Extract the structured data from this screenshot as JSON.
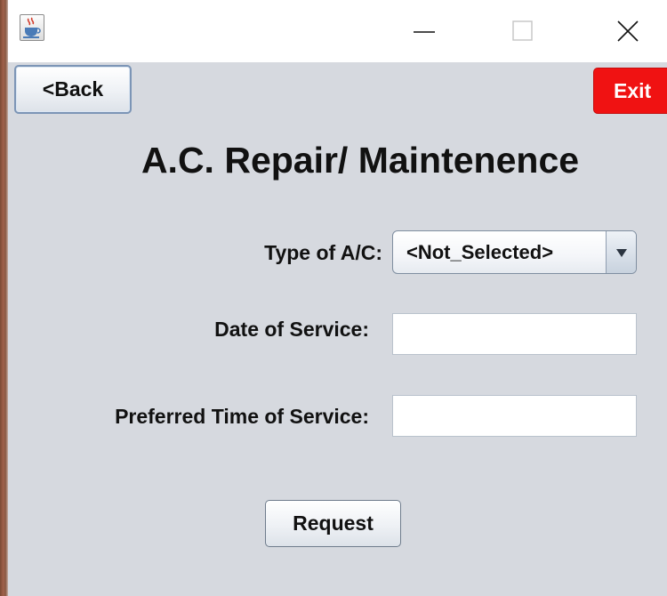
{
  "window": {
    "controls": [
      "minimize-icon",
      "maximize-icon",
      "close-icon"
    ],
    "app_icon": "java-cup-icon"
  },
  "nav": {
    "back_label": "<Back",
    "exit_label": "Exit"
  },
  "page": {
    "title": "A.C. Repair/ Maintenence"
  },
  "form": {
    "type_label": "Type of A/C:",
    "type_value": "<Not_Selected>",
    "date_label": "Date of Service:",
    "date_value": "",
    "time_label": "Preferred Time of Service:",
    "time_value": "",
    "submit_label": "Request"
  },
  "colors": {
    "background": "#d6d9df",
    "exit": "#f01212",
    "focus_border": "#7c95b6"
  }
}
